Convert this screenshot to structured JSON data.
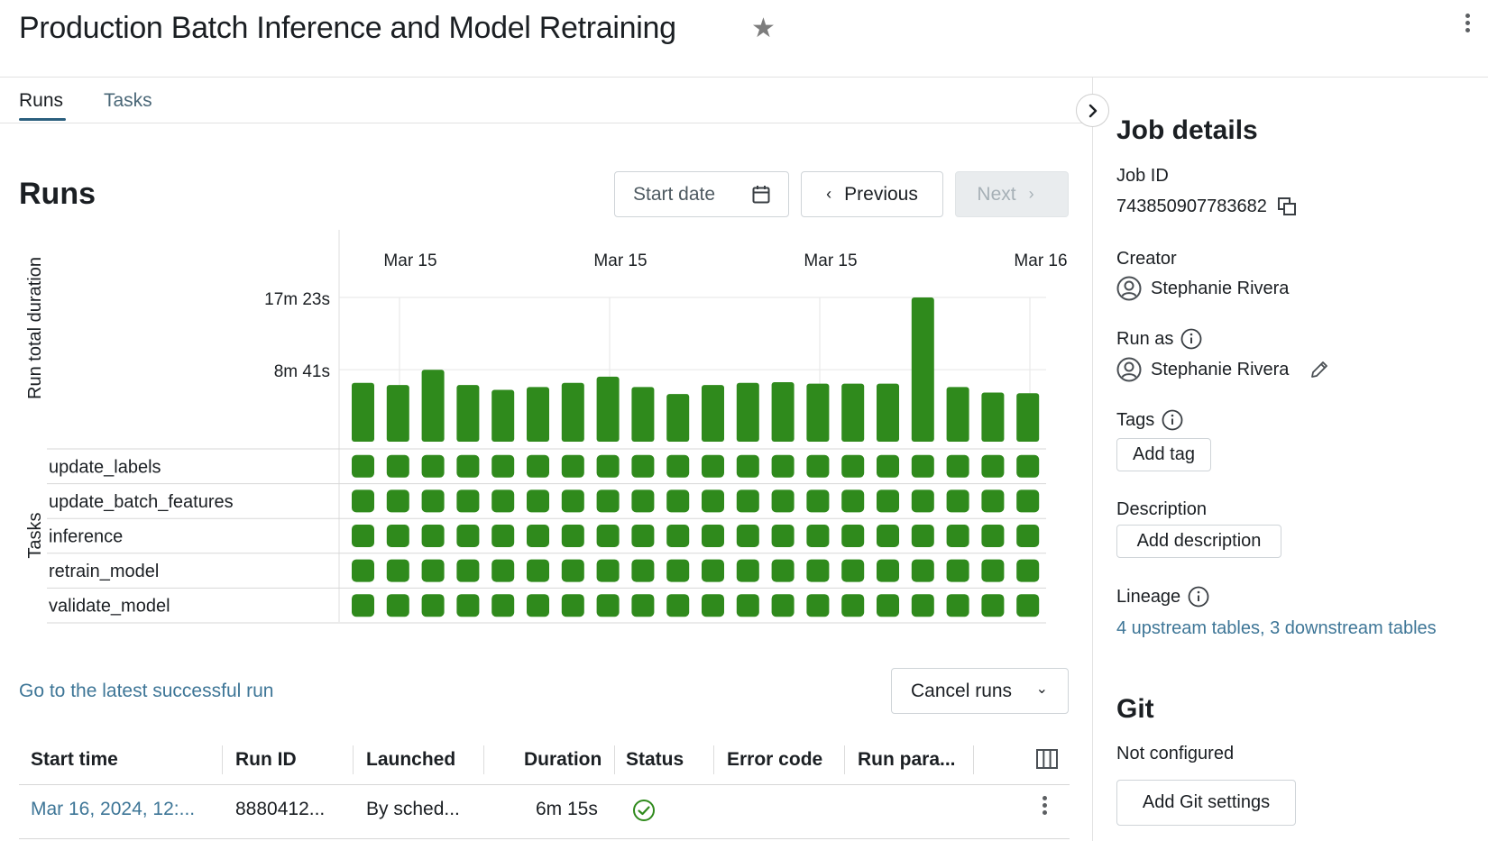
{
  "header": {
    "title": "Production Batch Inference and Model Retraining",
    "star_icon": "star-icon",
    "menu_icon": "kebab-menu-icon"
  },
  "tabs": [
    {
      "label": "Runs",
      "active": true
    },
    {
      "label": "Tasks",
      "active": false
    }
  ],
  "runs": {
    "heading": "Runs",
    "start_date_placeholder": "Start date",
    "previous_label": "Previous",
    "next_label": "Next",
    "latest_link": "Go to the latest successful run",
    "cancel_runs_label": "Cancel runs"
  },
  "chart_data": {
    "type": "bar",
    "title": "",
    "ylabel": "Run total duration",
    "tasks_label": "Tasks",
    "x_ticks": [
      "Mar 15",
      "Mar 15",
      "Mar 15",
      "Mar 16"
    ],
    "y_ticks": [
      "17m 23s",
      "8m 41s"
    ],
    "y_tick_seconds": [
      1043,
      521
    ],
    "ylim_seconds": [
      0,
      1043
    ],
    "values_seconds": [
      425,
      410,
      520,
      410,
      375,
      395,
      425,
      470,
      395,
      345,
      410,
      425,
      430,
      420,
      420,
      420,
      1043,
      395,
      355,
      350
    ],
    "tasks": [
      "update_labels",
      "update_batch_features",
      "inference",
      "retrain_model",
      "validate_model"
    ],
    "task_status": "success",
    "colors": {
      "bar": "#2f8a1c",
      "grid": "#e6e6e6"
    }
  },
  "table": {
    "columns": [
      "Start time",
      "Run ID",
      "Launched",
      "Duration",
      "Status",
      "Error code",
      "Run para..."
    ],
    "rows": [
      {
        "start_time": "Mar 16, 2024, 12:...",
        "run_id": "8880412...",
        "launched": "By sched...",
        "duration": "6m 15s",
        "status": "success",
        "error_code": "",
        "run_params": ""
      }
    ]
  },
  "job_details": {
    "title": "Job details",
    "job_id_label": "Job ID",
    "job_id": "743850907783682",
    "creator_label": "Creator",
    "creator": "Stephanie Rivera",
    "run_as_label": "Run as",
    "run_as": "Stephanie Rivera",
    "tags_label": "Tags",
    "add_tag": "Add tag",
    "description_label": "Description",
    "add_description": "Add description",
    "lineage_label": "Lineage",
    "lineage_link": "4 upstream tables, 3 downstream tables"
  },
  "git": {
    "title": "Git",
    "status": "Not configured",
    "add_settings": "Add Git settings"
  },
  "colors": {
    "accent": "#2b5f7e",
    "link": "#3e7697",
    "success": "#2f8a1c"
  }
}
